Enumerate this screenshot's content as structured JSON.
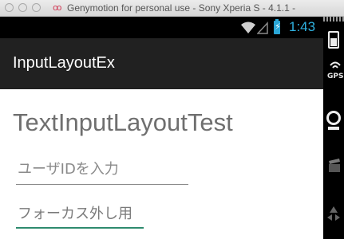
{
  "window": {
    "title": "Genymotion for personal use - Sony Xperia S - 4.1.1 -",
    "logo_glyph": "oo"
  },
  "status_bar": {
    "time": "1:43",
    "icons": [
      "wifi-icon",
      "signal-icon",
      "battery-charging-icon"
    ]
  },
  "app_bar": {
    "title": "InputLayoutEx"
  },
  "main": {
    "heading": "TextInputLayoutTest",
    "user_id_field": {
      "hint": "ユーザIDを入力"
    },
    "focus_field": {
      "value": "フォーカス外し用"
    }
  },
  "genymotion_toolbar": {
    "icons": [
      "battery-tool-icon",
      "gps-icon",
      "camera-icon",
      "capture-icon",
      "dpad-icon"
    ],
    "gps_label": "GPS"
  },
  "colors": {
    "status_bar_bg": "#000000",
    "app_bar_bg": "#212121",
    "clock": "#2fb2e0",
    "accent_underline": "#2e8b6e",
    "text_gray": "#6f6f6f"
  }
}
